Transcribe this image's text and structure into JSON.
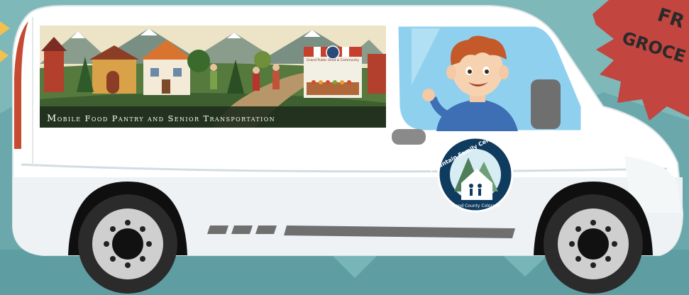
{
  "banner": {
    "caption": "Mobile Food Pantry and Senior Transportation",
    "market_sign": "Grand Public Shed & Community"
  },
  "logo": {
    "org_name": "Mountain Family Center",
    "location": "Grand County Colorado"
  },
  "starburst": {
    "line1": "FR",
    "line2": "GROCE"
  },
  "colors": {
    "sky": "#7fb8b9",
    "van_body": "#ffffff",
    "window": "#8fd0ef",
    "starburst": "#c2453f",
    "logo_ring": "#0f3b5e",
    "tire": "#2b2b2b"
  }
}
